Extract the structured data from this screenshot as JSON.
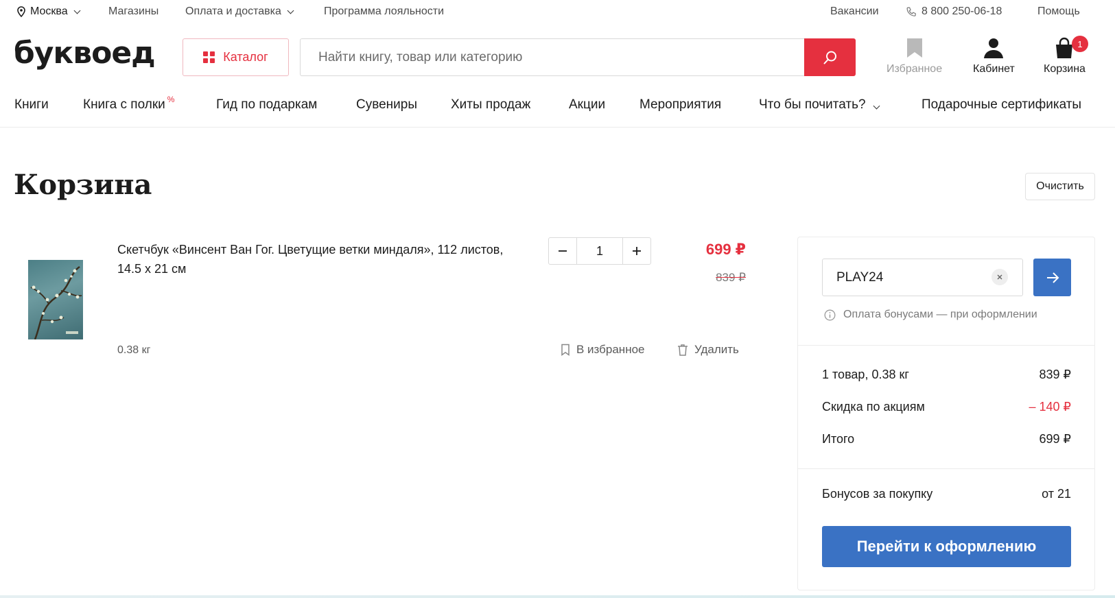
{
  "topbar": {
    "city": "Москва",
    "stores": "Магазины",
    "payment": "Оплата и доставка",
    "loyalty": "Программа лояльности",
    "jobs": "Вакансии",
    "phone": "8 800 250-06-18",
    "help": "Помощь"
  },
  "header": {
    "logo": "буквоед",
    "catalog_label": "Каталог",
    "search_placeholder": "Найти книгу, товар или категорию",
    "favorites_label": "Избранное",
    "cabinet_label": "Кабинет",
    "cart_label": "Корзина",
    "cart_count": "1"
  },
  "nav": {
    "books": "Книги",
    "book_shelf": "Книга с полки",
    "book_shelf_badge": "%",
    "gift_guide": "Гид по подаркам",
    "souvenirs": "Сувениры",
    "bestsellers": "Хиты продаж",
    "promotions": "Акции",
    "events": "Мероприятия",
    "what_to_read": "Что бы почитать?",
    "gift_certificates": "Подарочные сертификаты"
  },
  "cart": {
    "title": "Корзина",
    "clear_label": "Очистить",
    "item": {
      "title": "Скетчбук «Винсент Ван Гог. Цветущие ветки миндаля», 112 листов, 14.5 х 21 см",
      "weight": "0.38 кг",
      "quantity": "1",
      "price": "699 ₽",
      "old_price": "839 ₽",
      "favorite_label": "В избранное",
      "delete_label": "Удалить"
    }
  },
  "summary": {
    "promo_value": "PLAY24",
    "bonus_info": "Оплата бонусами — при оформлении",
    "items_label": "1 товар, 0.38 кг",
    "items_value": "839 ₽",
    "discount_label": "Скидка по акциям",
    "discount_value": "– 140 ₽",
    "total_label": "Итого",
    "total_value": "699 ₽",
    "bonus_label": "Бонусов за покупку",
    "bonus_value": "от 21",
    "checkout_label": "Перейти к оформлению"
  },
  "colors": {
    "brand_red": "#e5303f",
    "accent_blue": "#3a72c4"
  }
}
